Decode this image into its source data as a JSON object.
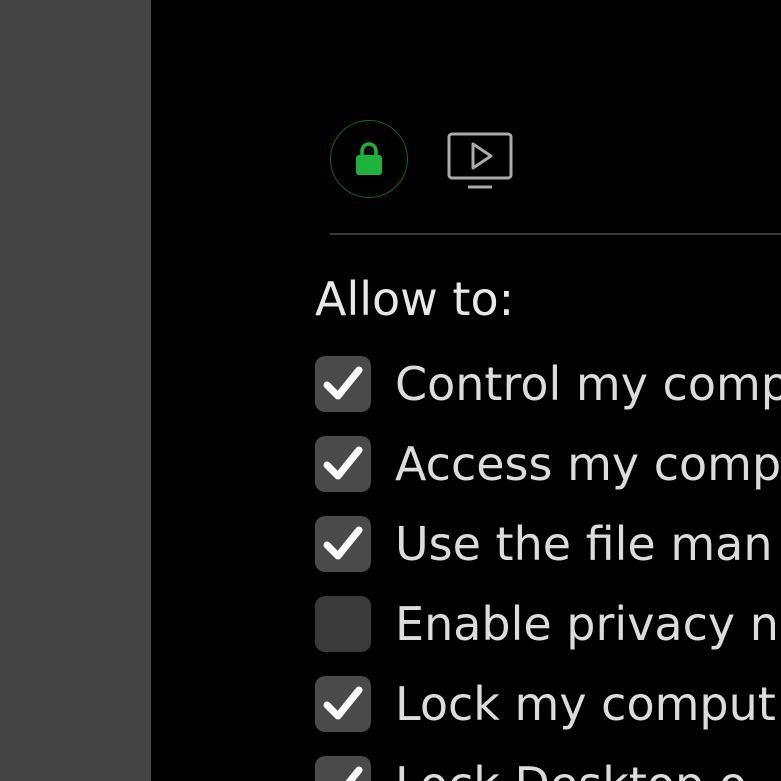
{
  "toolbar": {
    "lock_icon": "lock-icon",
    "screen_icon": "screen-play-icon",
    "accent_color": "#1db33a"
  },
  "permissions": {
    "title": "Allow to:",
    "items": [
      {
        "label": "Control my comp",
        "checked": true
      },
      {
        "label": "Access my comp",
        "checked": true
      },
      {
        "label": "Use the file man",
        "checked": true
      },
      {
        "label": "Enable privacy n",
        "checked": false
      },
      {
        "label": "Lock my comput",
        "checked": true
      },
      {
        "label": "Lock Desktop o",
        "checked": true
      }
    ]
  }
}
